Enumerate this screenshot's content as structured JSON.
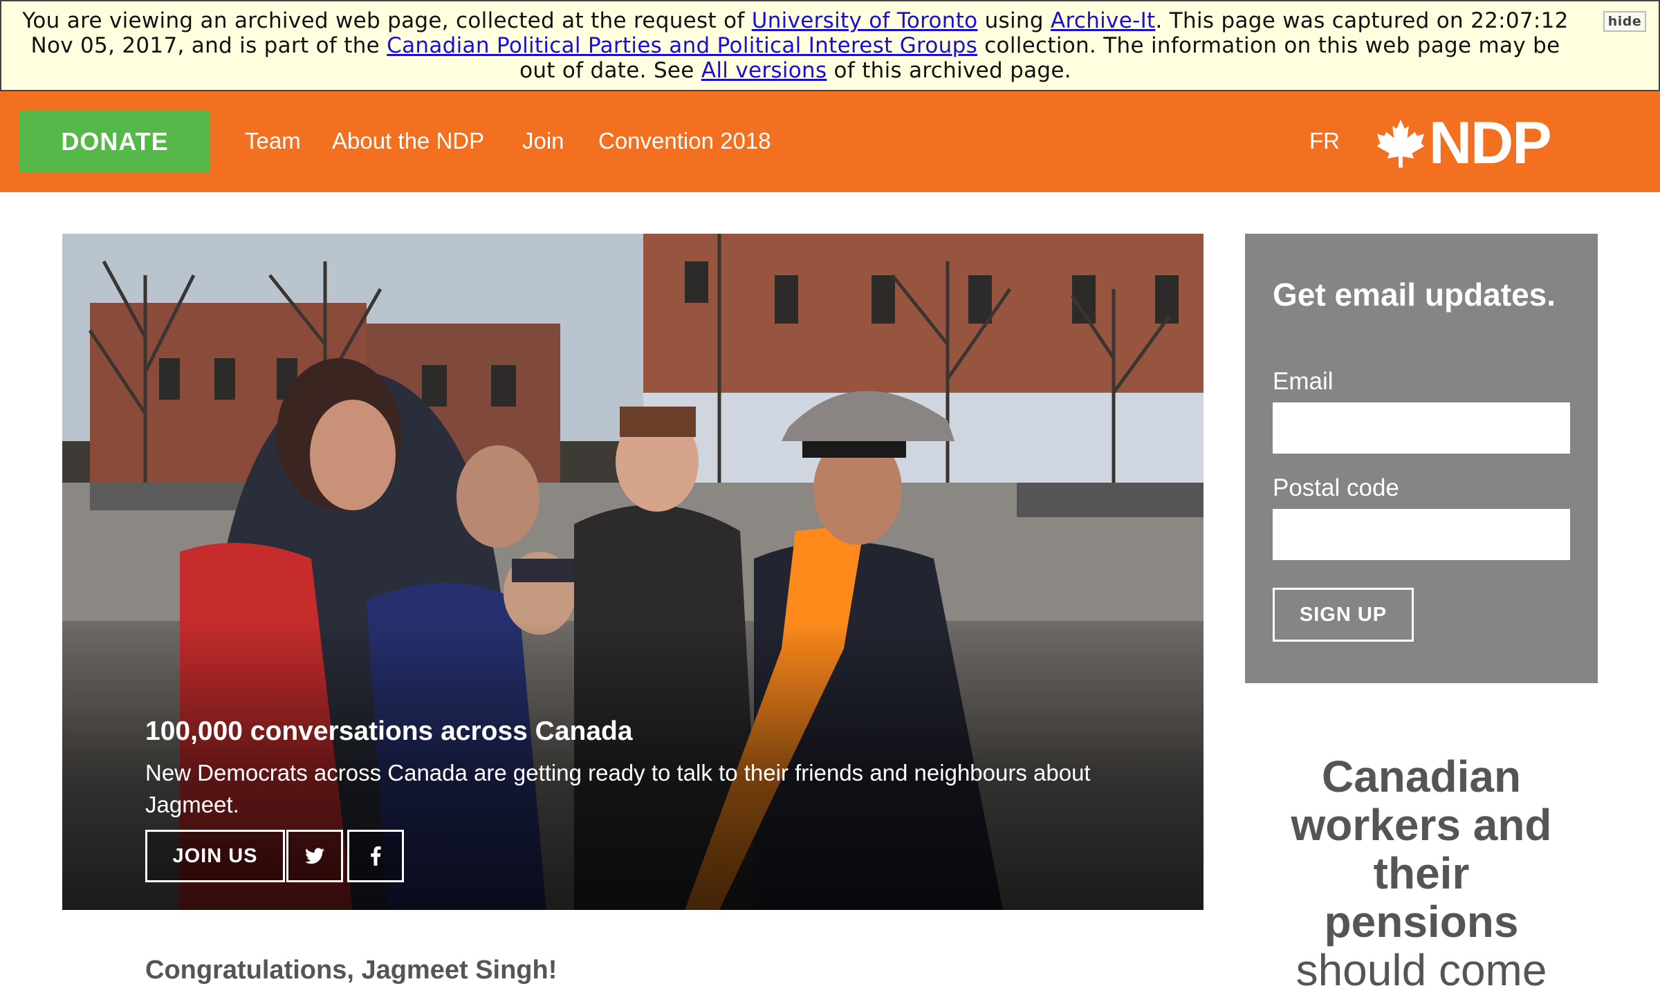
{
  "archive_banner": {
    "text_1": "You are viewing an archived web page, collected at the request of ",
    "link_org": "University of Toronto",
    "text_2": " using ",
    "link_tool": "Archive-It",
    "text_3": ". This page was captured on 22:07:12 Nov 05, 2017, and is part of the ",
    "link_collection": "Canadian Political Parties and Political Interest Groups",
    "text_4": " collection. The information on this web page may be out of date. See ",
    "link_versions": "All versions",
    "text_5": " of this archived page.",
    "hide_label": "hide"
  },
  "nav": {
    "donate_label": "DONATE",
    "links": [
      "Team",
      "About the NDP",
      "Join",
      "Convention 2018"
    ],
    "lang": "FR",
    "logo_text": "NDP",
    "background_color": "#f37021",
    "donate_color": "#55b848"
  },
  "hero": {
    "title": "100,000 conversations across Canada",
    "description": "New Democrats across Canada are getting ready to talk to their friends and neighbours about Jagmeet.",
    "join_label": "JOIN US",
    "twitter_icon": "twitter-icon",
    "facebook_icon": "facebook-icon"
  },
  "main": {
    "next_heading": "Congratulations, Jagmeet Singh!"
  },
  "signup": {
    "title": "Get email updates.",
    "email_label": "Email",
    "email_value": "",
    "postal_label": "Postal code",
    "postal_value": "",
    "button_label": "SIGN UP",
    "background_color": "#858585"
  },
  "sidebar_quote": {
    "line_1": "Canadian",
    "line_2": "workers and",
    "line_3": "their",
    "line_4": "pensions",
    "line_5": "should come"
  }
}
